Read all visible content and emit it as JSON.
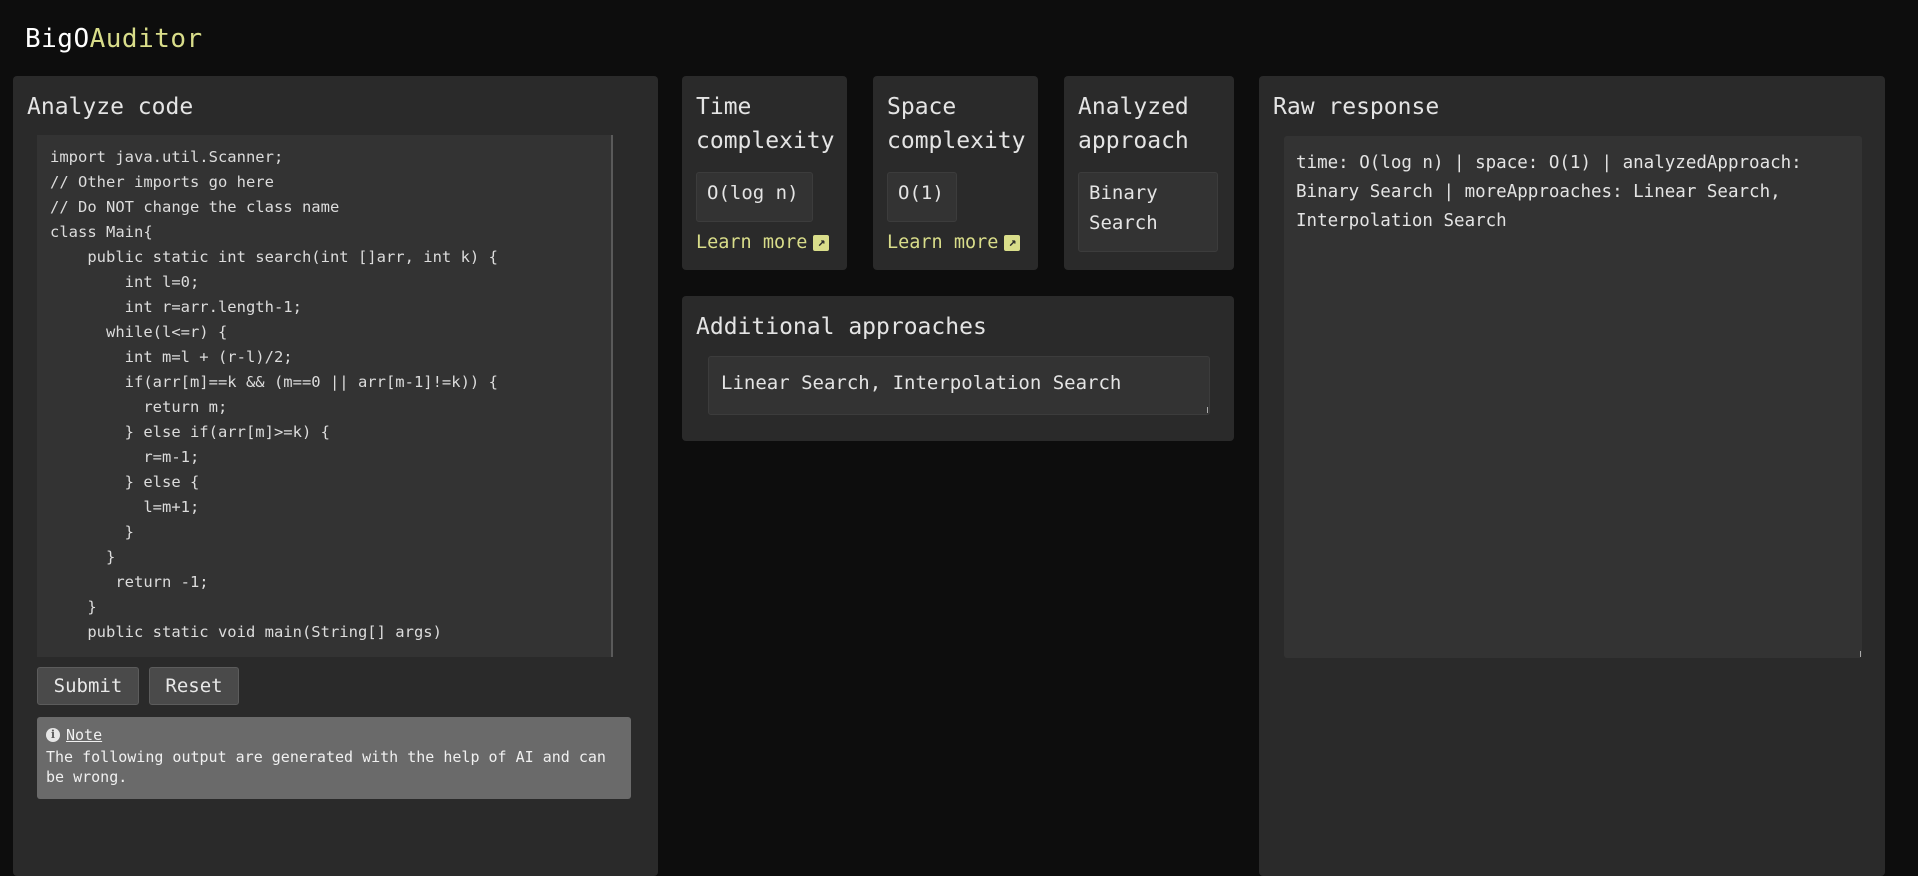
{
  "app": {
    "logo_part1": "BigO",
    "logo_part2": "Auditor"
  },
  "analyze": {
    "title": "Analyze code",
    "code": "import java.util.Scanner;\n// Other imports go here\n// Do NOT change the class name\nclass Main{\n    public static int search(int []arr, int k) {\n        int l=0;\n        int r=arr.length-1;\n      while(l<=r) {\n        int m=l + (r-l)/2;\n        if(arr[m]==k && (m==0 || arr[m-1]!=k)) {\n          return m;\n        } else if(arr[m]>=k) {\n          r=m-1;\n        } else {\n          l=m+1;\n        }\n      }\n       return -1;\n    }\n    public static void main(String[] args)",
    "submit_label": "Submit",
    "reset_label": "Reset",
    "note_label": "Note",
    "note_text": "The following output are generated with the help of AI and can be wrong."
  },
  "time": {
    "title": "Time complexity",
    "value": "O(log n)",
    "learn_more": "Learn more"
  },
  "space": {
    "title": "Space complexity",
    "value": "O(1)",
    "learn_more": "Learn more"
  },
  "approach": {
    "title": "Analyzed approach",
    "value": "Binary Search"
  },
  "additional": {
    "title": "Additional approaches",
    "value": "Linear Search, Interpolation Search"
  },
  "raw": {
    "title": "Raw response",
    "text": "time: O(log n) | space: O(1) | analyzedApproach: Binary Search | moreApproaches: Linear Search, Interpolation Search"
  },
  "colors": {
    "accent": "#d9dd8a",
    "background": "#0d0d0d",
    "panel": "#2a2a2a"
  },
  "icons": {
    "note": "info-icon",
    "learn_more": "external-link-icon"
  }
}
